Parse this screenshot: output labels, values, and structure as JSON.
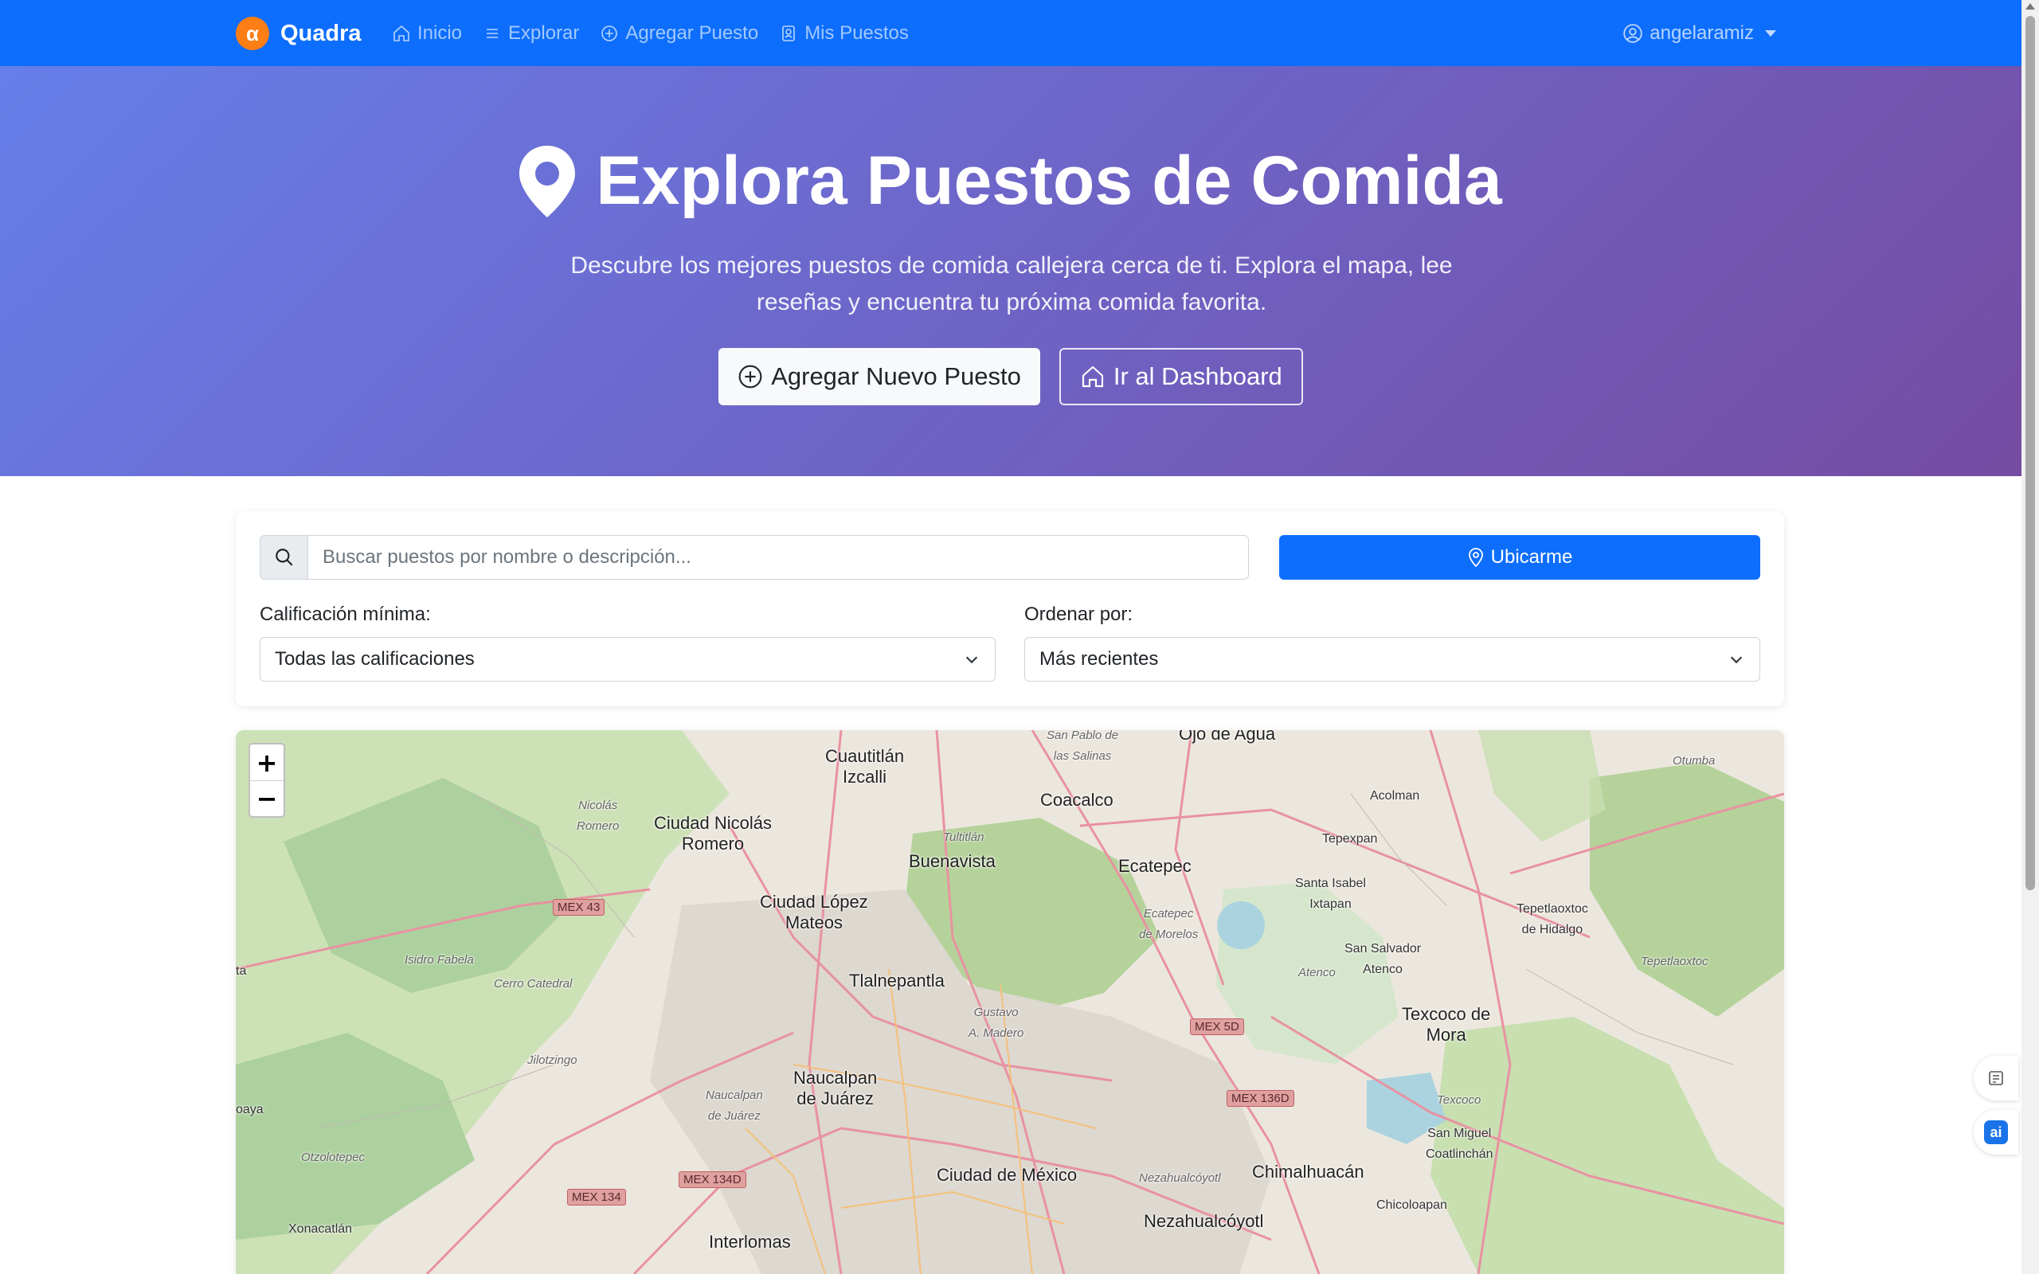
{
  "navbar": {
    "brand": {
      "logo_glyph": "α",
      "name": "Quadra"
    },
    "links": [
      {
        "label": "Inicio",
        "icon": "house-icon"
      },
      {
        "label": "Explorar",
        "icon": "list-icon"
      },
      {
        "label": "Agregar Puesto",
        "icon": "plus-circle-icon"
      },
      {
        "label": "Mis Puestos",
        "icon": "badge-icon"
      }
    ],
    "user": {
      "name": "angelaramiz",
      "icon": "person-circle-icon"
    }
  },
  "hero": {
    "title": "Explora Puestos de Comida",
    "subtitle": "Descubre los mejores puestos de comida callejera cerca de ti. Explora el mapa, lee reseñas y encuentra tu próxima comida favorita.",
    "primary_button": "Agregar Nuevo Puesto",
    "secondary_button": "Ir al Dashboard"
  },
  "filters": {
    "search_placeholder": "Buscar puestos por nombre o descripción...",
    "locate_button": "Ubicarme",
    "rating_label": "Calificación mínima:",
    "rating_value": "Todas las calificaciones",
    "sort_label": "Ordenar por:",
    "sort_value": "Más recientes"
  },
  "map": {
    "zoom_in": "+",
    "zoom_out": "−",
    "labels": {
      "cuautitlan": "Cuautitlán\nIzcalli",
      "cd_nicolas": "Ciudad Nicolás\nRomero",
      "coacalco": "Coacalco",
      "ecatepec": "Ecatepec",
      "buenavista": "Buenavista",
      "cd_lopez_mateos": "Ciudad López\nMateos",
      "tlalnepantla": "Tlalnepantla",
      "naucalpan": "Naucalpan\nde Juárez",
      "cdmx": "Ciudad de México",
      "nezahualcoyotl": "Nezahualcóyotl",
      "chimalhuacan": "Chimalhuacán",
      "texcoco": "Texcoco de\nMora",
      "interlomas": "Interlomas",
      "xonacatlan": "Xonacatlán",
      "ojo_de_agua": "Ojo de Agua",
      "acolman": "Acolman",
      "tepexpan": "Tepexpan",
      "santa_isabel": "Santa Isabel\nIxtapan",
      "san_salvador": "San Salvador\nAtenco",
      "tepetlaoxtoc": "Tepetlaoxtoc\nde Hidalgo",
      "san_miguel": "San Miguel\nCoatlinchán",
      "chicoloapan": "Chicoloapan",
      "nicolas_romero_sm": "Nicolás\nRomero",
      "isidro_fabela": "Isidro Fabela",
      "cerro_catedral": "Cerro Catedral",
      "jilotzingo": "Jilotzingo",
      "otzolotepec": "Otzolotepec",
      "tultitlan": "Tultitlán",
      "ecatepec_morelos": "Ecatepec\nde Morelos",
      "atenco": "Atenco",
      "texcoco_sm": "Texcoco",
      "tepetlaoxtoc_sm": "Tepetlaoxtoc",
      "otumba": "Otumba",
      "gustavo_madero": "Gustavo\nA. Madero",
      "naucalpan_sm": "Naucalpan\nde Juárez",
      "nezahualcoyotl_sm": "Nezahualcóyotl",
      "san_pablo": "San Pablo de\nlas Salinas",
      "zinacantepec_edge": "ta",
      "edge_oaya": "oaya"
    },
    "shields": [
      "MEX 43",
      "MEX 5D",
      "MEX 136D",
      "MEX 134D",
      "MEX 134"
    ]
  },
  "colors": {
    "navbar": "#0d6efd",
    "hero_start": "#667eea",
    "hero_end": "#764ba2",
    "primary": "#0d6efd",
    "brand_logo": "#fd7e14"
  }
}
